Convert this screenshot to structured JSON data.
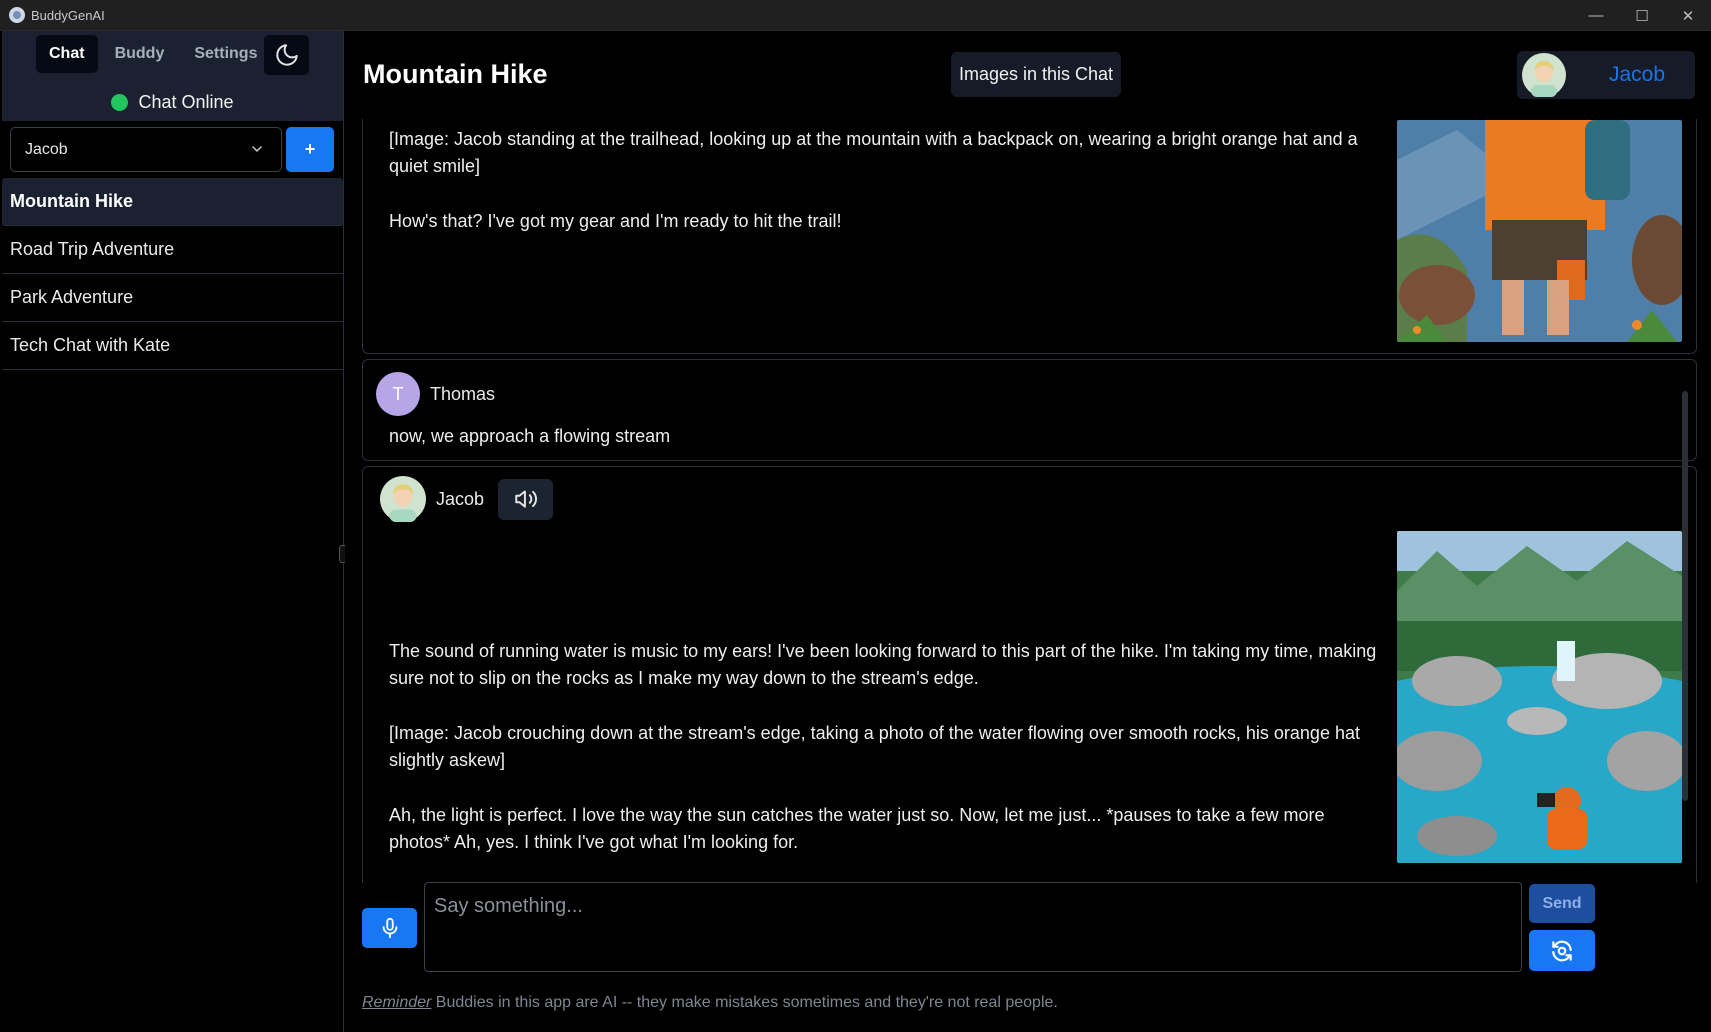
{
  "app": {
    "title": "BuddyGenAI"
  },
  "window_controls": {
    "minimize": "—",
    "maximize": "☐",
    "close": "✕"
  },
  "sidebar": {
    "tabs": [
      {
        "label": "Chat"
      },
      {
        "label": "Buddy"
      },
      {
        "label": "Settings"
      }
    ],
    "status": "Chat Online",
    "buddy_select": {
      "value": "Jacob"
    },
    "add_label": "+",
    "chats": [
      {
        "label": "Mountain Hike"
      },
      {
        "label": "Road Trip Adventure"
      },
      {
        "label": "Park Adventure"
      },
      {
        "label": "Tech Chat with Kate"
      }
    ]
  },
  "header": {
    "title": "Mountain Hike",
    "images_button": "Images in this Chat",
    "profile_name": "Jacob"
  },
  "messages": [
    {
      "paragraphs": [
        "[Image: Jacob standing at the trailhead, looking up at the mountain with a backpack on, wearing a bright orange hat and a quiet smile]",
        "How's that? I've got my gear and I'm ready to hit the trail!"
      ]
    },
    {
      "sender": "Thomas",
      "avatar_initial": "T",
      "paragraphs": [
        "now, we approach a flowing stream"
      ]
    },
    {
      "sender": "Jacob",
      "paragraphs": [
        "The sound of running water is music to my ears! I've been looking forward to this part of the hike. I'm taking my time, making sure not to slip on the rocks as I make my way down to the stream's edge.",
        "[Image: Jacob crouching down at the stream's edge, taking a photo of the water flowing over smooth rocks, his orange hat slightly askew]",
        "Ah, the light is perfect. I love the way the sun catches the water just so. Now, let me just... *pauses to take a few more photos* Ah, yes. I think I've got what I'm looking for."
      ]
    }
  ],
  "composer": {
    "placeholder": "Say something...",
    "send_label": "Send"
  },
  "footer": {
    "reminder_label": "Reminder",
    "reminder_text": " Buddies in this app are AI -- they make mistakes sometimes and they're not real people."
  },
  "colors": {
    "accent": "#1877f2",
    "online": "#22c55e",
    "panel": "#1b2130"
  }
}
